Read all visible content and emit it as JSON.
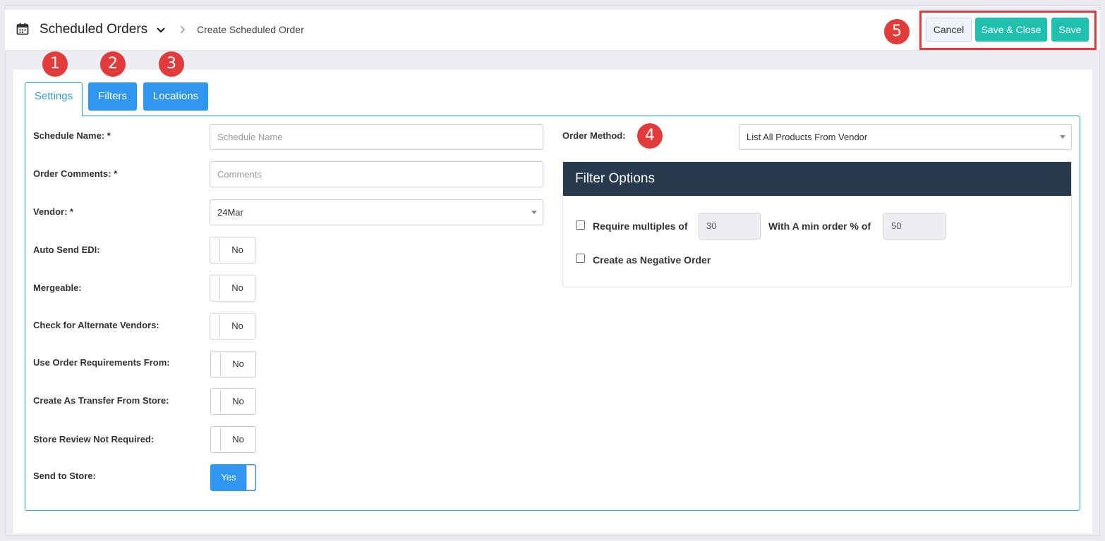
{
  "header": {
    "title": "Scheduled Orders",
    "breadcrumb": "Create Scheduled Order",
    "actions": {
      "cancel": "Cancel",
      "save_close": "Save & Close",
      "save": "Save"
    }
  },
  "annotations": [
    "1",
    "2",
    "3",
    "4",
    "5"
  ],
  "tabs": [
    {
      "label": "Settings",
      "active": true
    },
    {
      "label": "Filters",
      "active": false
    },
    {
      "label": "Locations",
      "active": false
    }
  ],
  "form": {
    "schedule_name": {
      "label": "Schedule Name: *",
      "placeholder": "Schedule Name",
      "value": ""
    },
    "order_comments": {
      "label": "Order Comments: *",
      "placeholder": "Comments",
      "value": ""
    },
    "vendor": {
      "label": "Vendor: *",
      "value": "24Mar"
    },
    "auto_send_edi": {
      "label": "Auto Send EDI:",
      "state": "No"
    },
    "mergeable": {
      "label": "Mergeable:",
      "state": "No"
    },
    "alternate_vendors": {
      "label": "Check for Alternate Vendors:",
      "state": "No"
    },
    "order_requirements": {
      "label": "Use Order Requirements From:",
      "state": "No"
    },
    "transfer_from_store": {
      "label": "Create As Transfer From Store:",
      "state": "No"
    },
    "store_review": {
      "label": "Store Review Not Required:",
      "state": "No"
    },
    "send_to_store": {
      "label": "Send to Store:",
      "state": "Yes"
    },
    "order_method": {
      "label": "Order Method:",
      "value": "List All Products From Vendor"
    }
  },
  "filter_options": {
    "title": "Filter Options",
    "require_multiples": {
      "label": "Require multiples of",
      "value": "30",
      "checked": false
    },
    "min_order": {
      "label": "With A min order % of",
      "value": "50"
    },
    "negative_order": {
      "label": "Create as Negative Order",
      "checked": false
    }
  },
  "colors": {
    "accent": "#2f97f0",
    "teal": "#1fc0b0",
    "badge": "#e23b3b",
    "panel_head": "#273a50"
  }
}
